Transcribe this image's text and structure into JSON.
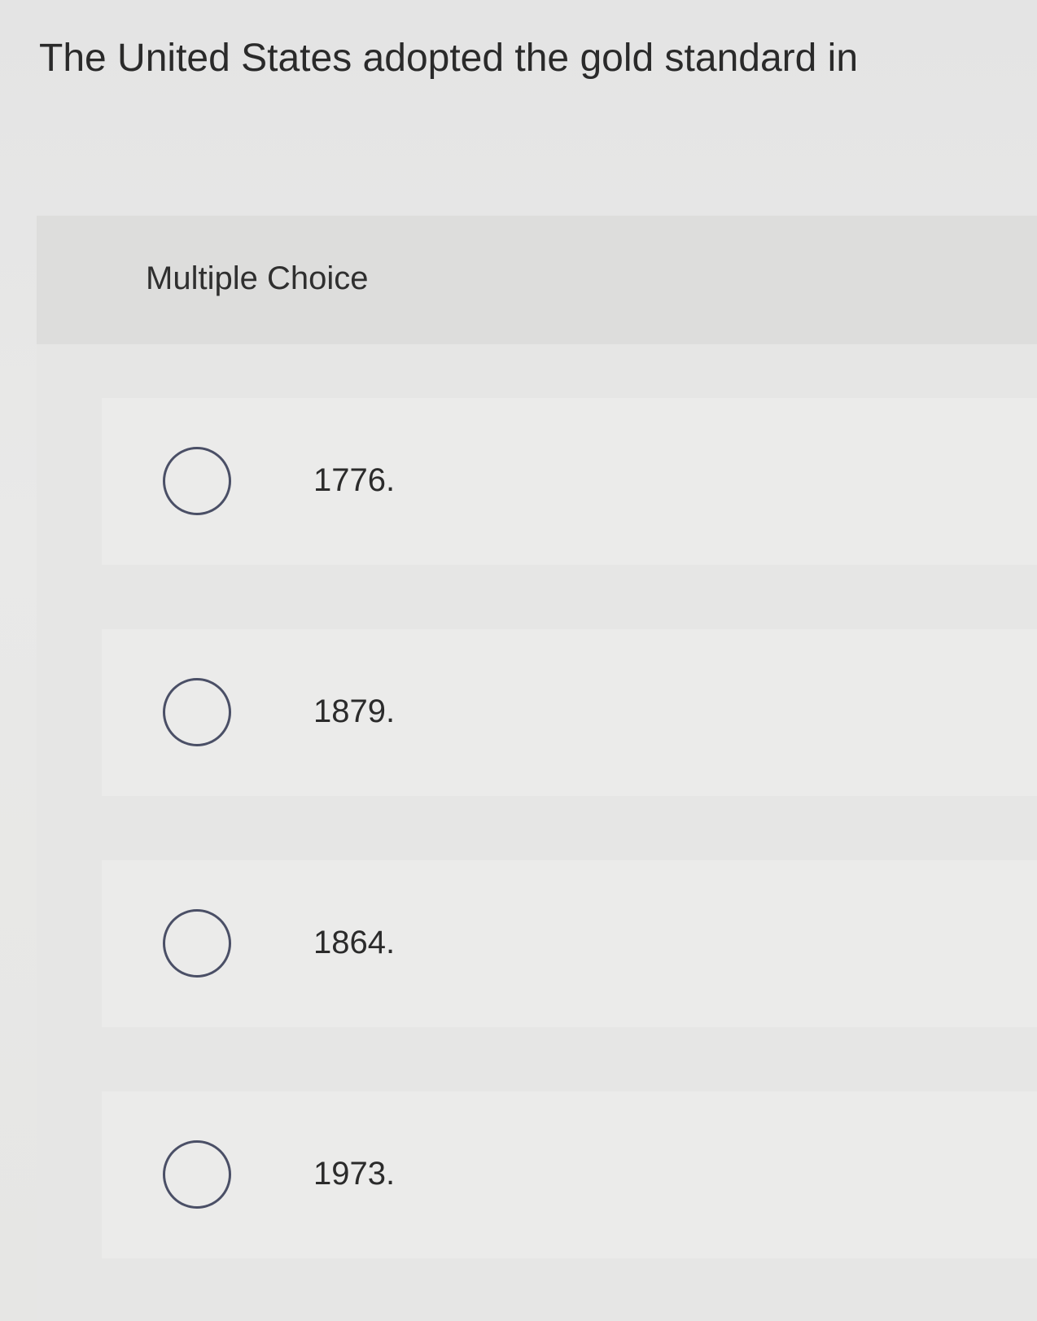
{
  "question": {
    "text": "The United States adopted the gold standard in"
  },
  "card": {
    "header_label": "Multiple Choice"
  },
  "options": [
    {
      "label": "1776.",
      "selected": false
    },
    {
      "label": "1879.",
      "selected": false
    },
    {
      "label": "1864.",
      "selected": false
    },
    {
      "label": "1973.",
      "selected": false
    }
  ]
}
